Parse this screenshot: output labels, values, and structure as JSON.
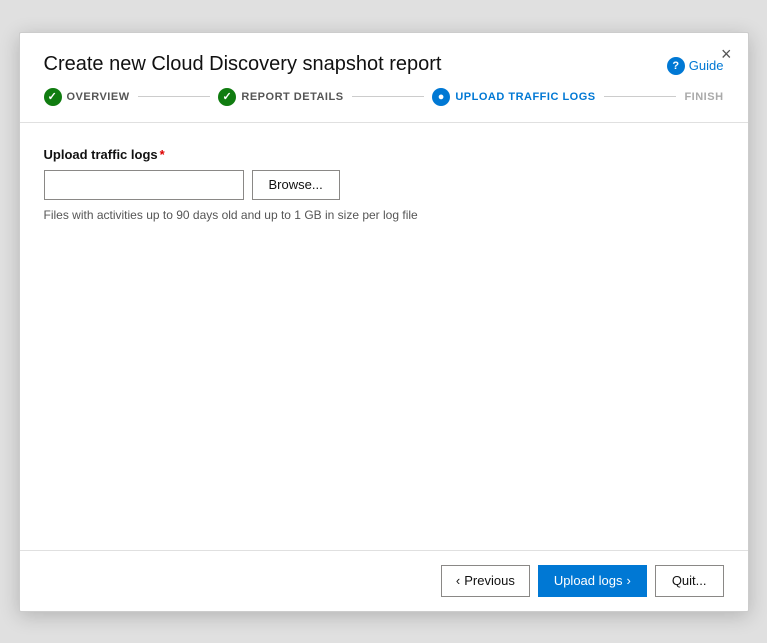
{
  "dialog": {
    "title": "Create new Cloud Discovery snapshot report",
    "close_label": "×"
  },
  "guide": {
    "label": "Guide",
    "icon": "?"
  },
  "stepper": {
    "steps": [
      {
        "id": "overview",
        "label": "OVERVIEW",
        "state": "completed"
      },
      {
        "id": "report-details",
        "label": "REPORT DETAILS",
        "state": "completed"
      },
      {
        "id": "upload-traffic-logs",
        "label": "UPLOAD TRAFFIC LOGS",
        "state": "active"
      },
      {
        "id": "finish",
        "label": "FINISH",
        "state": "inactive"
      }
    ]
  },
  "content": {
    "field_label": "Upload traffic logs",
    "required_marker": "*",
    "file_input_placeholder": "",
    "browse_button_label": "Browse...",
    "hint": "Files with activities up to 90 days old and up to 1 GB in size per log file"
  },
  "footer": {
    "previous_label": "Previous",
    "previous_icon": "‹",
    "upload_label": "Upload logs",
    "upload_icon": "›",
    "quit_label": "Quit..."
  }
}
